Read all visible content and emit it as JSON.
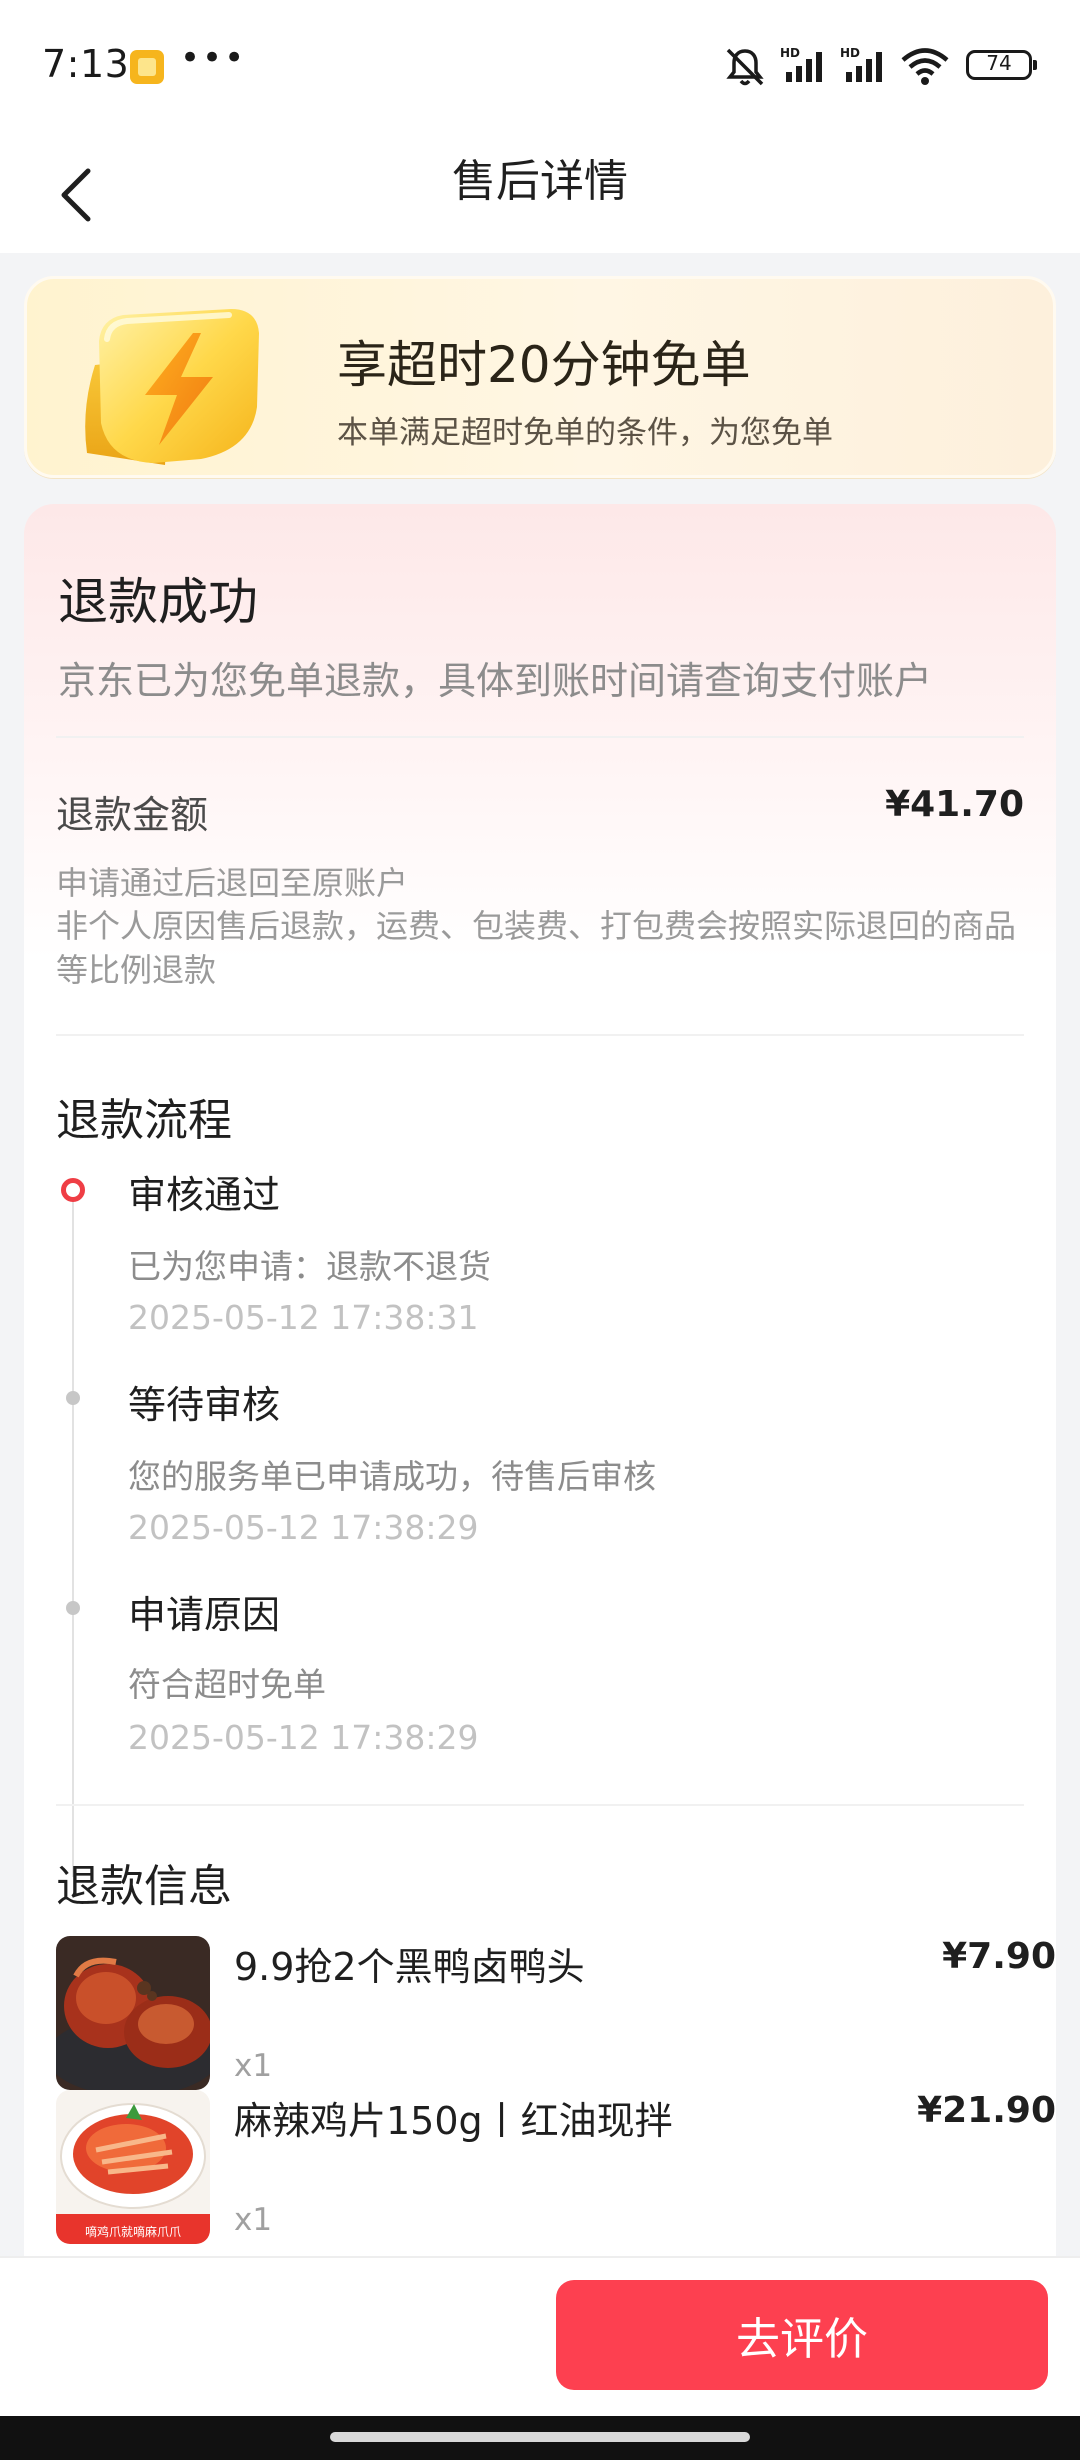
{
  "status_bar": {
    "time": "7:13",
    "dots": "•••",
    "battery": "74",
    "icons": [
      "app-notification-icon",
      "mute-icon",
      "signal-hd-1-icon",
      "signal-hd-2-icon",
      "wifi-icon",
      "battery-icon"
    ]
  },
  "header": {
    "title": "售后详情",
    "back_icon": "chevron-left-icon"
  },
  "promo": {
    "title": "享超时20分钟免单",
    "subtitle": "本单满足超时免单的条件，为您免单",
    "icon": "lightning-shield-icon"
  },
  "refund": {
    "status": "退款成功",
    "status_desc": "京东已为您免单退款，具体到账时间请查询支付账户",
    "amount_label": "退款金额",
    "amount_value": "¥41.70",
    "note1": "申请通过后退回至原账户",
    "note2": "非个人原因售后退款，运费、包装费、打包费会按照实际退回的商品等比例退款"
  },
  "process": {
    "title": "退款流程",
    "steps": [
      {
        "title": "审核通过",
        "desc": "已为您申请：退款不退货",
        "time": "2025-05-12 17:38:31",
        "active": true
      },
      {
        "title": "等待审核",
        "desc": "您的服务单已申请成功，待售后审核",
        "time": "2025-05-12 17:38:29",
        "active": false
      },
      {
        "title": "申请原因",
        "desc": "符合超时免单",
        "time": "2025-05-12 17:38:29",
        "active": false
      }
    ]
  },
  "refund_info": {
    "title": "退款信息",
    "items": [
      {
        "name": "9.9抢2个黑鸭卤鸭头",
        "price": "¥7.90",
        "qty": "x1"
      },
      {
        "name": "麻辣鸡片150g丨红油现拌",
        "price": "¥21.90",
        "qty": "x1",
        "thumb_caption": "嘀鸡爪就嘀麻爪爪"
      }
    ]
  },
  "actions": {
    "review_label": "去评价"
  },
  "colors": {
    "accent_red": "#fd4050",
    "timeline_active": "#ef3e45",
    "page_bg": "#f3f4f6"
  }
}
